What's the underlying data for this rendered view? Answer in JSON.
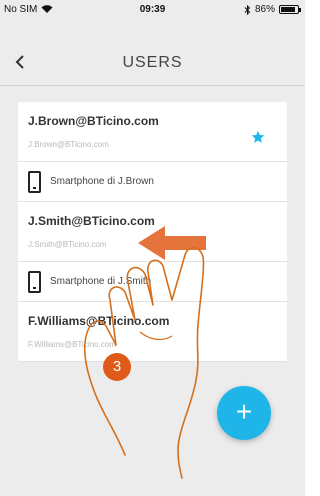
{
  "status_bar": {
    "carrier": "No SIM",
    "time": "09:39",
    "battery_percent": "86%",
    "battery_level": 0.86,
    "icons": [
      "wifi-icon",
      "bluetooth-icon",
      "battery-icon"
    ]
  },
  "header": {
    "title": "USERS",
    "back_icon": "chevron-left-icon"
  },
  "users": [
    {
      "email": "J.Brown@BTicino.com",
      "sub": "J.Brown@BTicino.com",
      "favorite": true,
      "device": "Smartphone di J.Brown"
    },
    {
      "email": "J.Smith@BTicino.com",
      "sub": "J.Smith@BTicino.com",
      "favorite": false,
      "device": "Smartphone di J.Smith"
    },
    {
      "email": "F.Williams@BTicino.com",
      "sub": "F.Williams@BTicino.com",
      "favorite": false
    }
  ],
  "fab": {
    "label": "+"
  },
  "gesture": {
    "step_number": "3",
    "colors": {
      "arrow": "#e05a1a",
      "hand_outline": "#d4701c",
      "badge": "#e05a1a"
    }
  },
  "colors": {
    "accent": "#1fb5e9",
    "star": "#1fb5e9"
  }
}
